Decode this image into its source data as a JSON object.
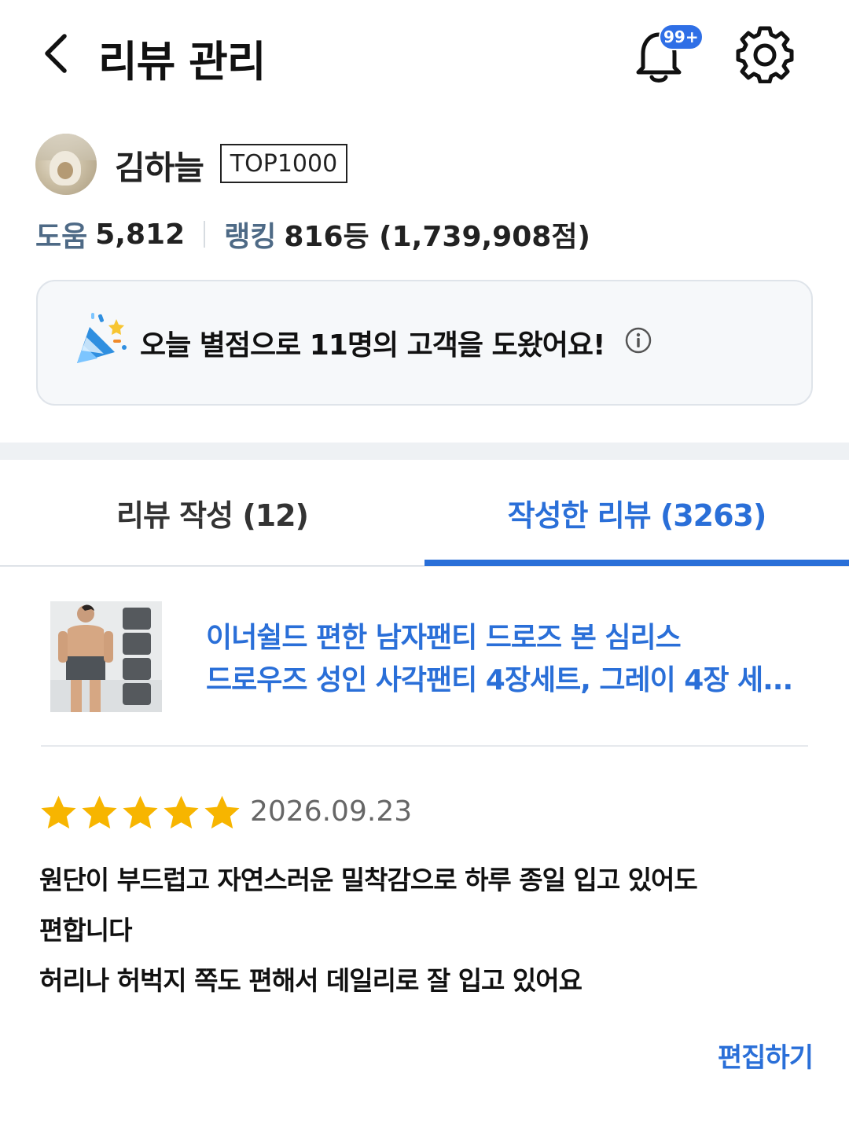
{
  "header": {
    "title": "리뷰 관리",
    "notification_badge": "99+"
  },
  "profile": {
    "name": "김하늘",
    "rank_badge": "TOP1000",
    "stats": {
      "help_label": "도움",
      "help_value": "5,812",
      "ranking_label": "랭킹",
      "ranking_value": "816등 (1,739,908점)"
    }
  },
  "help_banner": {
    "text": "오늘 별점으로 11명의 고객을 도왔어요!"
  },
  "tabs": [
    {
      "label": "리뷰 작성 (12)",
      "selected": false
    },
    {
      "label": "작성한 리뷰 (3263)",
      "selected": true
    }
  ],
  "product": {
    "title_line1": "이너쉴드 편한 남자팬티 드로즈 본 심리스",
    "title_line2": "드로우즈 성인 사각팬티 4장세트, 그레이 4장 세..."
  },
  "review": {
    "rating": 5,
    "max_rating": 5,
    "date": "2026.09.23",
    "lines": [
      "원단이 부드럽고 자연스러운 밀착감으로 하루 종일 입고 있어도",
      "편합니다",
      "허리나 허벅지 쪽도 편해서 데일리로 잘 입고 있어요"
    ],
    "edit_label": "편집하기"
  },
  "colors": {
    "accent": "#2a6fd8",
    "star": "#f7b500",
    "badge": "#2f6fe6"
  }
}
